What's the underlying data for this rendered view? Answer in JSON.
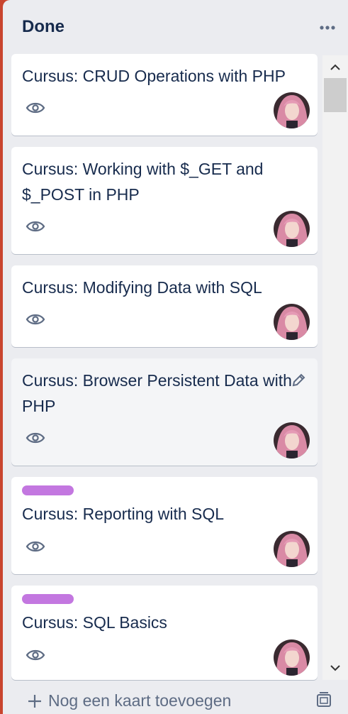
{
  "list": {
    "title": "Done",
    "menu_icon": "ellipsis-icon"
  },
  "cards": [
    {
      "title_lines": [
        "Cursus: CRUD Operations with PHP"
      ],
      "has_label": false,
      "label_color": null
    },
    {
      "title_lines": [
        "Cursus: Working with $_GET and",
        "$_POST in PHP"
      ],
      "has_label": false,
      "label_color": null
    },
    {
      "title_lines": [
        "Cursus: Modifying Data with SQL"
      ],
      "has_label": false,
      "label_color": null
    },
    {
      "title_lines": [
        "Cursus: Browser Persistent Data with",
        "PHP"
      ],
      "has_label": false,
      "label_color": null,
      "hover": true
    },
    {
      "title_lines": [
        "Cursus: Reporting with SQL"
      ],
      "has_label": true,
      "label_color": "#c377e0"
    },
    {
      "title_lines": [
        "Cursus: SQL Basics"
      ],
      "has_label": true,
      "label_color": "#c377e0"
    }
  ],
  "footer": {
    "add_card_label": "Nog een kaart toevoegen"
  },
  "colors": {
    "board_bg": "#c9452f",
    "list_bg": "#ebecf0",
    "text": "#172b4d",
    "muted": "#5e6c84",
    "label_purple": "#c377e0"
  }
}
